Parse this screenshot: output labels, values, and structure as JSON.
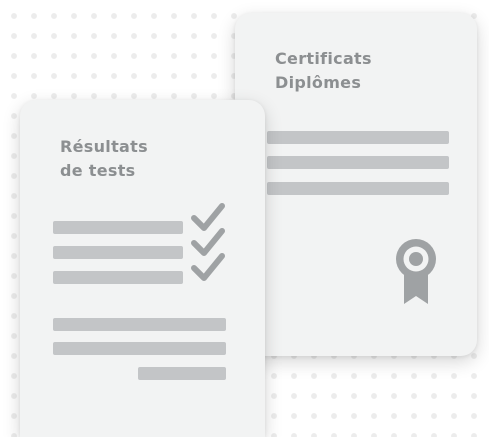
{
  "certificates_card": {
    "title_line1": "Certificats",
    "title_line2": "Diplômes",
    "icon": "ribbon-award-icon"
  },
  "test_results_card": {
    "title_line1": "Résultats",
    "title_line2": "de tests",
    "icon": "checkmark-icon"
  },
  "colors": {
    "card_background": "#f2f3f3",
    "text": "#8c8f91",
    "bars": "#c3c5c7",
    "icons": "#9fa2a4",
    "background_dots": "#ececec"
  }
}
